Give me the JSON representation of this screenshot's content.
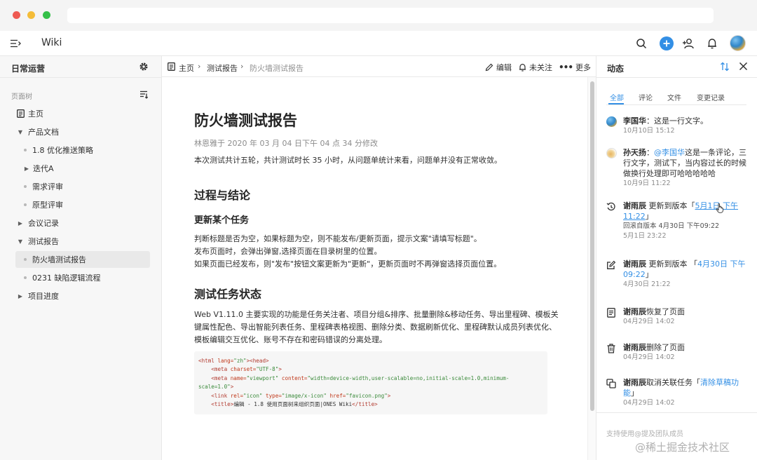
{
  "app": {
    "title": "Wiki"
  },
  "sidebar": {
    "title": "日常运营",
    "section_label": "页面树",
    "tree": [
      {
        "label": "主页",
        "kind": "home"
      },
      {
        "label": "产品文档",
        "kind": "expanded"
      },
      {
        "label": "1.8 优化推送策略",
        "kind": "leaf"
      },
      {
        "label": "迭代A",
        "kind": "collapsed"
      },
      {
        "label": "需求评审",
        "kind": "leaf"
      },
      {
        "label": "原型评审",
        "kind": "leaf"
      },
      {
        "label": "会议记录",
        "kind": "collapsed"
      },
      {
        "label": "测试报告",
        "kind": "expanded"
      },
      {
        "label": "防火墙测试报告",
        "kind": "selected"
      },
      {
        "label": "0231 缺陷逻辑流程",
        "kind": "leaf"
      },
      {
        "label": "项目进度",
        "kind": "collapsed"
      }
    ]
  },
  "breadcrumb": {
    "home": "主页",
    "parent": "测试报告",
    "current": "防火墙测试报告"
  },
  "actions": {
    "edit": "编辑",
    "follow": "未关注",
    "more": "更多"
  },
  "document": {
    "title": "防火墙测试报告",
    "meta": "林恩雅于 2020 年 03 月 04 日下午 04 点 34 分修改",
    "intro": "本次测试共计五轮，共计测试时长 35 小时，从问题单统计来看，问题单并没有正常收敛。",
    "h2_1": "过程与结论",
    "h3_1": "更新某个任务",
    "para_lines": [
      "判断标题是否为空，如果标题为空，则不能发布/更新页面，提示文案\"请填写标题\"。",
      "发布页面时，会弹出弹窗,选择页面在目录树里的位置。",
      "如果页面已经发布，则\"发布\"按钮文案更新为\"更新\"，更新页面时不再弹窗选择页面位置。"
    ],
    "h2_2": "测试任务状态",
    "status_lines": [
      "Web V1.11.0 主要实现的功能是任务关注者、项目分组&排序、批量删除&移动任务、导出里程碑、模板关",
      "键属性配色、导出智能列表任务、里程碑表格视图、删除分类、数据刷新优化、里程碑默认成员列表优化、",
      "模板编辑交互优化、账号不存在和密码错误的分离处理。"
    ],
    "code": {
      "l1_tag_open": "<html ",
      "l1_attr": "lang=",
      "l1_val": "\"zh\"",
      "l1_tag_close": "><head>",
      "l2_tag": "<meta ",
      "l2_attr": "charset=",
      "l2_val": "\"UTF-8\"",
      "l2_end": ">",
      "l3_tag": "<meta ",
      "l3_attr1": "name=",
      "l3_val1": "\"viewport\"",
      "l3_attr2": " content=",
      "l3_val2": "\"width=device-width,user-scalable=no,initial-scale=1.0,minimum-",
      "l4_val": "scale=1.0\"",
      "l4_end": ">",
      "l5_tag": "<link ",
      "l5_attr1": "rel=",
      "l5_val1": "\"icon\"",
      "l5_attr2": " type=",
      "l5_val2": "\"image/x-icon\"",
      "l5_attr3": " href=",
      "l5_val3": "\"favicon.png\"",
      "l5_end": ">",
      "l6_tag": "<title>",
      "l6_text": "编辑 - 1.8 使用页面树来组织页面|ONES Wiki",
      "l6_end": "</title>"
    }
  },
  "activity": {
    "title": "动态",
    "tabs": [
      "全部",
      "评论",
      "文件",
      "变更记录"
    ],
    "items": [
      {
        "actor": "李国华",
        "sep": "：",
        "text": "这是一行文字。",
        "time": "10月10日 15:12"
      },
      {
        "actor": "孙天扬",
        "sep": "：",
        "mention": "@李国华",
        "text_l1": "这是一条评论，三",
        "text_l2": "行文字，测试下，当内容过长的时候",
        "text_l3": "做换行处理即可哈哈哈哈哈",
        "time": "10月9日 11:22"
      },
      {
        "actor": "谢雨辰",
        "action": " 更新到版本「",
        "link_l1": "5月1日 下午",
        "link_l2": "11:22",
        "close": "」",
        "extra": "回滚自版本 4月30日 下午09:22",
        "time": "5月1日 23:22"
      },
      {
        "actor": "谢雨辰",
        "action": " 更新到版本 「",
        "link_l1": "4月30日 下午",
        "link_l2": "09:22",
        "close": "」",
        "time": "4月30日 21:22"
      },
      {
        "actor": "谢雨辰",
        "action": "恢复了页面",
        "time": "04月29日 14:02"
      },
      {
        "actor": "谢雨辰",
        "action": "删除了页面",
        "time": "04月29日 14:02"
      },
      {
        "actor": "谢雨辰",
        "action": "取消关联任务「",
        "link_l1": "清除草稿功",
        "link_l2": "能",
        "close": "」",
        "time": "04月29日 14:02"
      }
    ],
    "comment_placeholder": "支持使用@提及团队成员"
  },
  "watermark": "@稀土掘金技术社区",
  "colors": {
    "accent": "#338fe5",
    "sidebar_bg": "#f7f7f7",
    "selected_bg": "#e9e9e9"
  }
}
